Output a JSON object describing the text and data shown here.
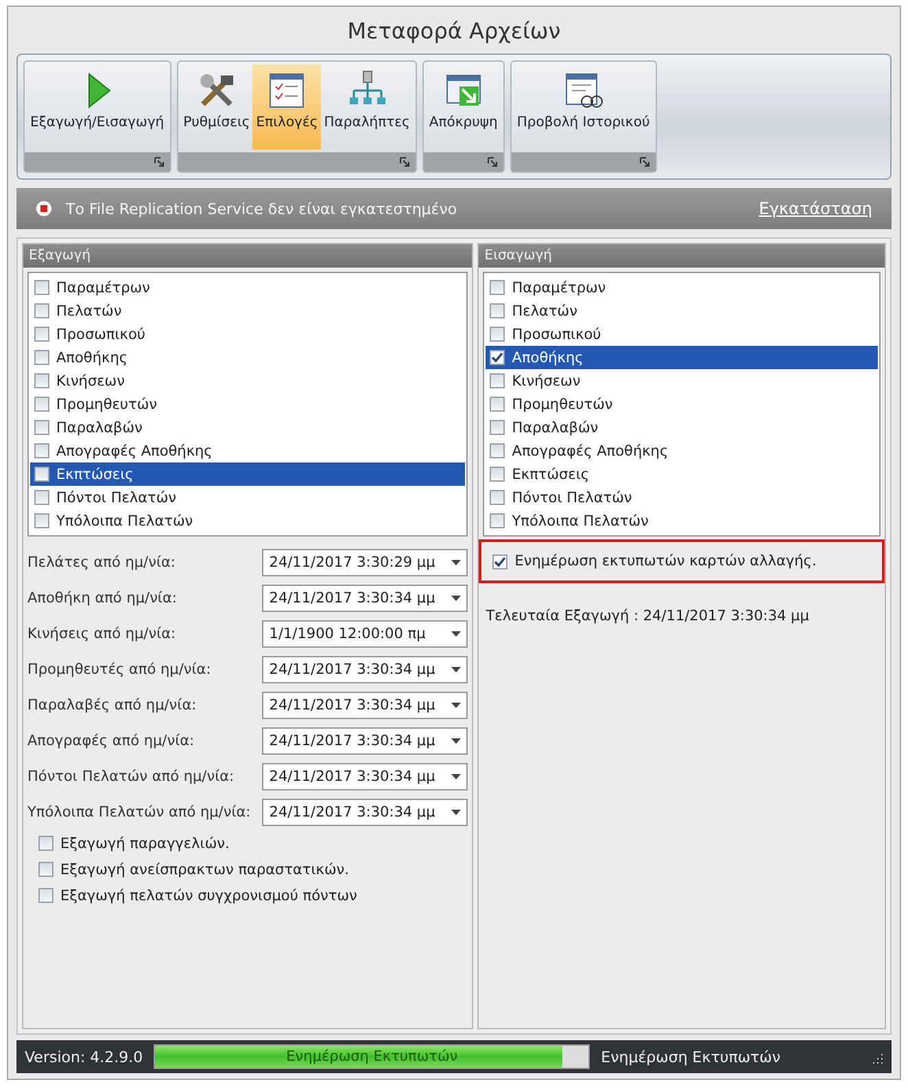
{
  "window": {
    "title": "Μεταφορά Αρχείων"
  },
  "ribbon": {
    "groups": [
      {
        "buttons": [
          {
            "label": "Εξαγωγή/Εισαγωγή",
            "kind": "play",
            "selected": false
          }
        ]
      },
      {
        "buttons": [
          {
            "label": "Ρυθμίσεις",
            "kind": "tools",
            "selected": false
          },
          {
            "label": "Επιλογές",
            "kind": "checklist",
            "selected": true
          },
          {
            "label": "Παραλήπτες",
            "kind": "network",
            "selected": false
          }
        ]
      },
      {
        "buttons": [
          {
            "label": "Απόκρυψη",
            "kind": "hide",
            "selected": false
          }
        ]
      },
      {
        "buttons": [
          {
            "label": "Προβολή Ιστορικού",
            "kind": "history",
            "selected": false
          }
        ]
      }
    ]
  },
  "notice": {
    "message": "Το File Replication Service δεν είναι εγκατεστημένο",
    "link": "Εγκατάσταση"
  },
  "export_panel": {
    "title": "Εξαγωγή",
    "items": [
      {
        "label": "Παραμέτρων",
        "checked": false,
        "selected": false
      },
      {
        "label": "Πελατών",
        "checked": false,
        "selected": false
      },
      {
        "label": "Προσωπικού",
        "checked": false,
        "selected": false
      },
      {
        "label": "Αποθήκης",
        "checked": false,
        "selected": false
      },
      {
        "label": "Κινήσεων",
        "checked": false,
        "selected": false
      },
      {
        "label": "Προμηθευτών",
        "checked": false,
        "selected": false
      },
      {
        "label": "Παραλαβών",
        "checked": false,
        "selected": false
      },
      {
        "label": "Απογραφές Αποθήκης",
        "checked": false,
        "selected": false
      },
      {
        "label": "Εκπτώσεις",
        "checked": false,
        "selected": true
      },
      {
        "label": "Πόντοι Πελατών",
        "checked": false,
        "selected": false
      },
      {
        "label": "Υπόλοιπα Πελατών",
        "checked": false,
        "selected": false
      }
    ],
    "date_fields": [
      {
        "label": "Πελάτες από ημ/νία:",
        "value": "24/11/2017 3:30:29 μμ"
      },
      {
        "label": "Αποθήκη από ημ/νία:",
        "value": "24/11/2017 3:30:34 μμ"
      },
      {
        "label": "Κινήσεις από ημ/νία:",
        "value": "1/1/1900 12:00:00 πμ"
      },
      {
        "label": "Προμηθευτές από ημ/νία:",
        "value": "24/11/2017 3:30:34 μμ"
      },
      {
        "label": "Παραλαβές από ημ/νία:",
        "value": "24/11/2017 3:30:34 μμ"
      },
      {
        "label": "Απογραφές από ημ/νία:",
        "value": "24/11/2017 3:30:34 μμ"
      },
      {
        "label": "Πόντοι Πελατών από ημ/νία:",
        "value": "24/11/2017 3:30:34 μμ"
      },
      {
        "label": "Υπόλοιπα Πελατών από ημ/νία:",
        "value": "24/11/2017 3:30:34 μμ"
      }
    ],
    "options": [
      {
        "label": "Εξαγωγή παραγγελιών.",
        "checked": false
      },
      {
        "label": "Εξαγωγή ανείσπρακτων παραστατικών.",
        "checked": false
      },
      {
        "label": "Εξαγωγή πελατών συγχρονισμού πόντων",
        "checked": false
      }
    ]
  },
  "import_panel": {
    "title": "Εισαγωγή",
    "items": [
      {
        "label": "Παραμέτρων",
        "checked": false,
        "selected": false
      },
      {
        "label": "Πελατών",
        "checked": false,
        "selected": false
      },
      {
        "label": "Προσωπικού",
        "checked": false,
        "selected": false
      },
      {
        "label": "Αποθήκης",
        "checked": true,
        "selected": true
      },
      {
        "label": "Κινήσεων",
        "checked": false,
        "selected": false
      },
      {
        "label": "Προμηθευτών",
        "checked": false,
        "selected": false
      },
      {
        "label": "Παραλαβών",
        "checked": false,
        "selected": false
      },
      {
        "label": "Απογραφές Αποθήκης",
        "checked": false,
        "selected": false
      },
      {
        "label": "Εκπτώσεις",
        "checked": false,
        "selected": false
      },
      {
        "label": "Πόντοι Πελατών",
        "checked": false,
        "selected": false
      },
      {
        "label": "Υπόλοιπα Πελατών",
        "checked": false,
        "selected": false
      }
    ],
    "print_update": {
      "label": "Ενημέρωση εκτυπωτών καρτών αλλαγής.",
      "checked": true,
      "highlighted": true
    },
    "last_export": "Τελευταία Εξαγωγή : 24/11/2017 3:30:34 μμ"
  },
  "status_bar": {
    "version": "Version: 4.2.9.0",
    "progress": {
      "level": 0.94,
      "label": "Ενημέρωση Εκτυπωτών"
    },
    "status": "Ενημέρωση Εκτυπωτών"
  }
}
